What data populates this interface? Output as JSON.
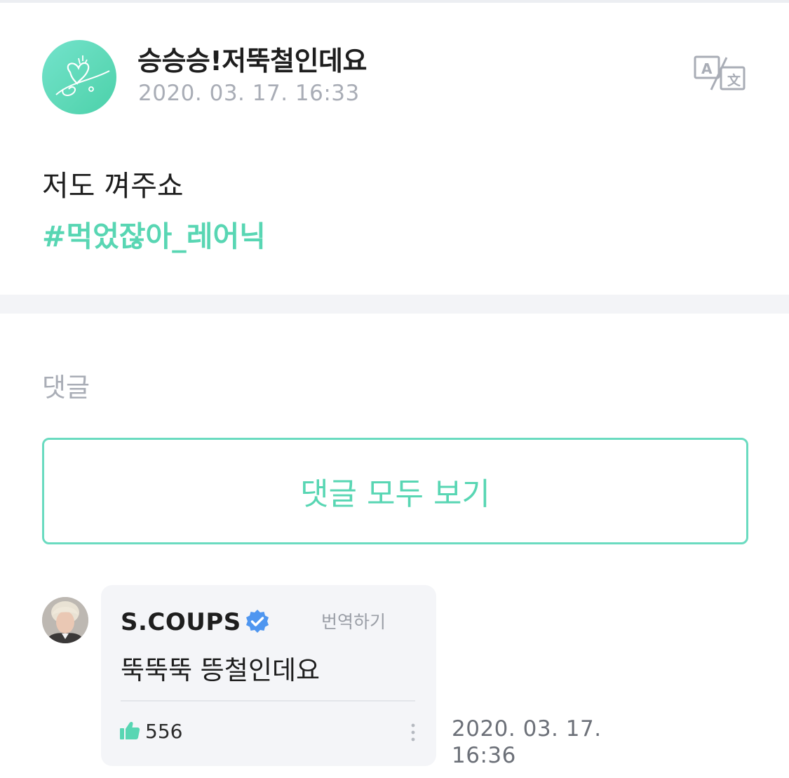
{
  "post": {
    "author": "승승승!저뚝철인데요",
    "date": "2020. 03. 17. 16:33",
    "text": "저도 껴주쇼",
    "hashtag": "#먹었잖아_레어닉"
  },
  "comments_section": {
    "label": "댓글",
    "view_all_label": "댓글 모두 보기"
  },
  "comment": {
    "author": "S.COUPS",
    "translate_label": "번역하기",
    "text": "뚝뚝뚝 뜽철인데요",
    "likes": "556",
    "date": "2020. 03. 17. 16:36"
  },
  "colors": {
    "accent": "#58d6b3",
    "verified": "#4f96f0",
    "muted_text": "#a9adb6"
  },
  "icons": [
    "translate-icon",
    "verified-badge-icon",
    "thumbs-up-icon",
    "more-vertical-icon",
    "heart-doodle-avatar"
  ]
}
